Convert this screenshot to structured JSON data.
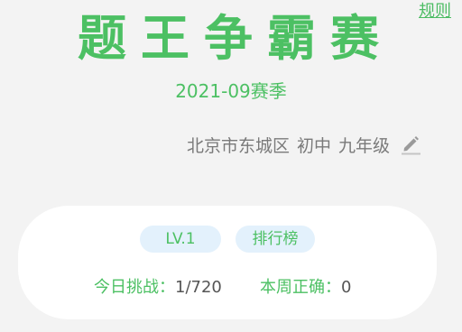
{
  "header": {
    "rules_link": "规则",
    "title": "题王争霸赛",
    "season": "2021-09赛季"
  },
  "profile": {
    "location": "北京市东城区",
    "school_level": "初中",
    "grade": "九年级",
    "edit_icon": "pencil-edit-icon"
  },
  "card": {
    "level_label": "LV.1",
    "ranking_label": "排行榜",
    "today_label": "今日挑战：",
    "today_value": "1/720",
    "week_label": "本周正确：",
    "week_value": "0"
  },
  "colors": {
    "accent": "#4cc063",
    "pill_bg": "#e3f1fc",
    "background": "#f3f3f3",
    "text_gray": "#7a7a7a"
  }
}
